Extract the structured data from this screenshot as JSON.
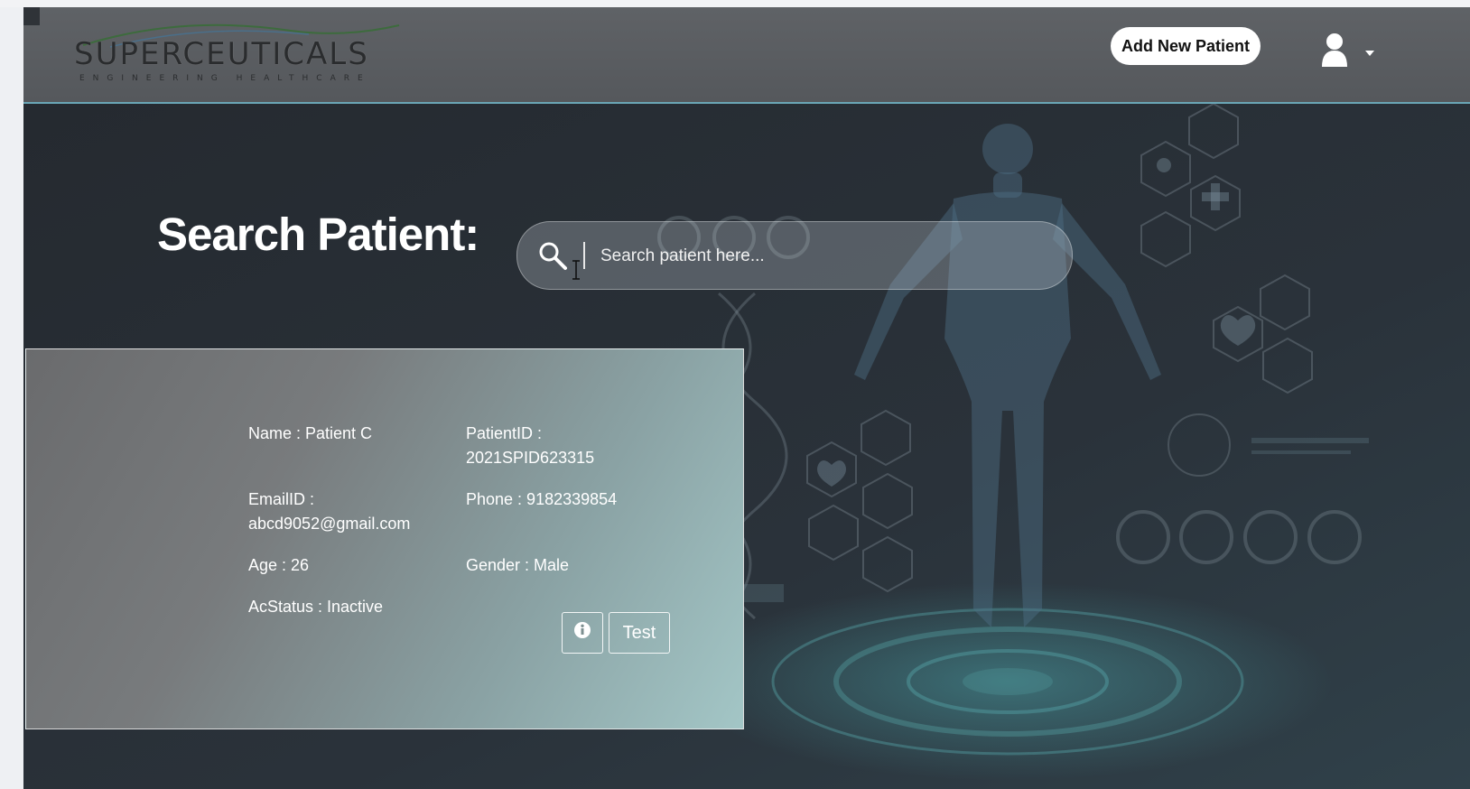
{
  "brand": {
    "logo_text": "SUPERCEUTICALS",
    "tagline": "ENGINEERING HEALTHCARE"
  },
  "header": {
    "add_patient_label": "Add New Patient",
    "user_icon": "user-icon",
    "menu_caret_icon": "caret-down-icon"
  },
  "search": {
    "title": "Search Patient:",
    "placeholder": "Search patient here...",
    "icon": "search-icon"
  },
  "patient": {
    "name": "Name : Patient C",
    "patient_id": "PatientID :\n2021SPID623315",
    "email": "EmailID :\nabcd9052@gmail.com",
    "phone": "Phone : 9182339854",
    "age": "Age : 26",
    "gender": "Gender : Male",
    "status": "AcStatus : Inactive",
    "info_icon": "info-icon",
    "test_label": "Test"
  },
  "colors": {
    "background": "#272d33",
    "header": "#5b5e62",
    "header_border": "#6aa6b6",
    "accent": "#4fb3b8"
  }
}
